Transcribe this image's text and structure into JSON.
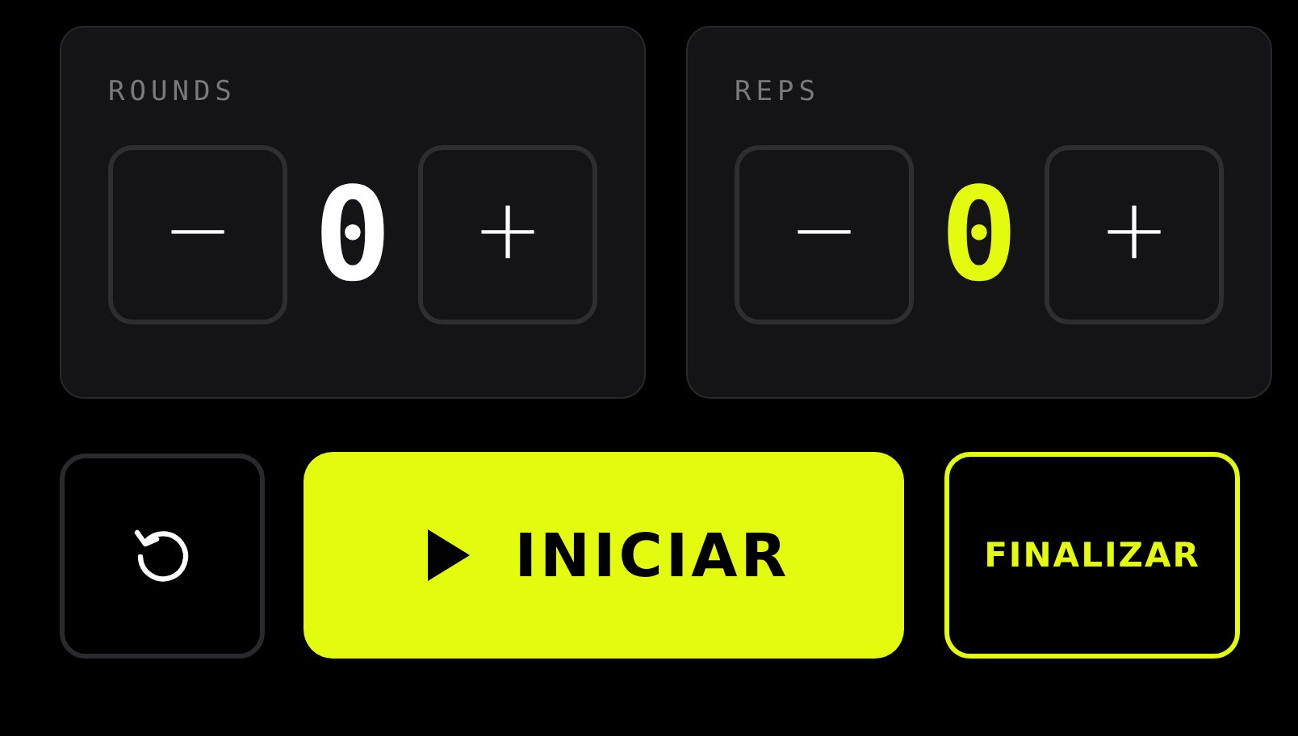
{
  "counters": [
    {
      "label": "ROUNDS",
      "value": "0",
      "color": "#ffffff",
      "decrement": "−",
      "increment": "+"
    },
    {
      "label": "REPS",
      "value": "0",
      "color": "#e2fb0e",
      "decrement": "−",
      "increment": "+"
    }
  ],
  "actions": [
    {
      "kind": "reset"
    },
    {
      "kind": "start",
      "label": "INICIAR"
    },
    {
      "kind": "finish",
      "label": "FINALIZAR"
    }
  ]
}
